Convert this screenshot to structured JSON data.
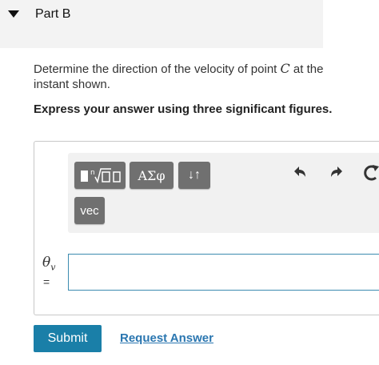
{
  "part": {
    "title": "Part B"
  },
  "question": {
    "text_before": "Determine the direction of the velocity of point ",
    "variable": "C",
    "text_after": " at the instant shown.",
    "instruction": "Express your answer using three significant figures."
  },
  "toolbar": {
    "templates_icon": "templates-icon",
    "symbols_label": "ΑΣφ",
    "updown_label": "↓↑",
    "vec_label": "vec",
    "undo_icon": "undo-icon",
    "redo_icon": "redo-icon",
    "reset_icon": "reset-icon"
  },
  "answer": {
    "variable": "θ",
    "subscript": "v",
    "equals": "=",
    "value": ""
  },
  "actions": {
    "submit_label": "Submit",
    "request_label": "Request Answer"
  },
  "colors": {
    "header_bg": "#f3f3f3",
    "tool_button": "#707070",
    "input_border": "#3c8bb0",
    "submit_bg": "#1a7fa8",
    "link": "#2a76b0"
  }
}
